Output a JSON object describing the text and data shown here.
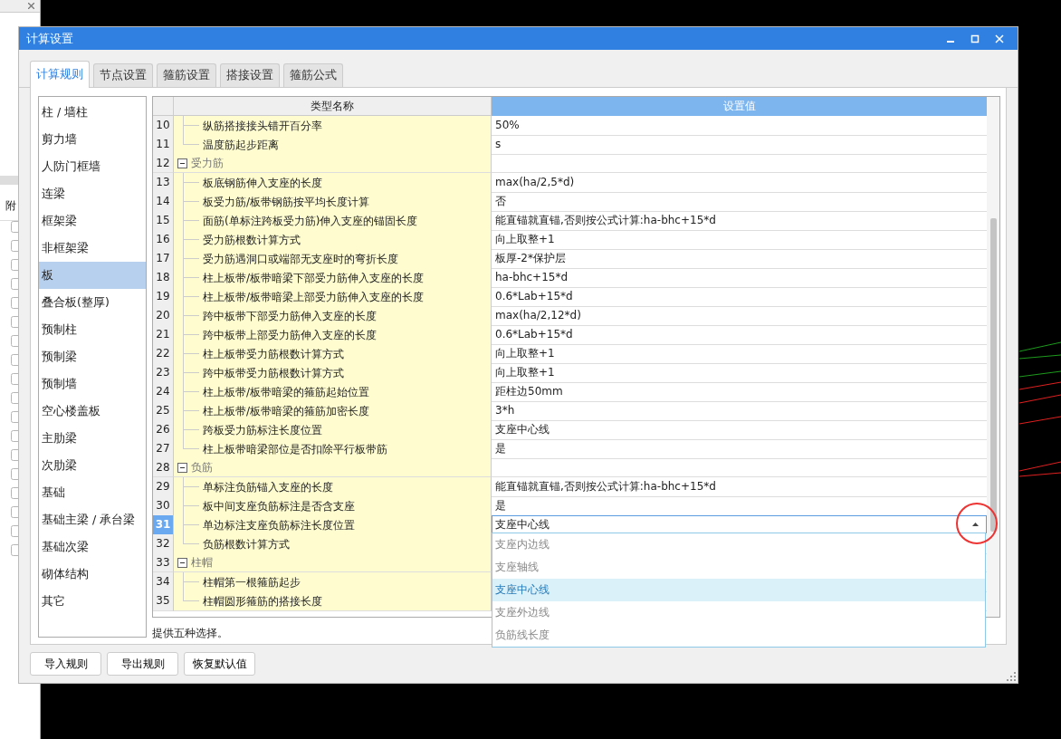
{
  "background_window": {
    "column_header": "附",
    "checkboxes": [
      {
        "checked": false
      },
      {
        "checked": false
      },
      {
        "checked": false
      },
      {
        "checked": false
      },
      {
        "checked": false
      },
      {
        "checked": false
      },
      {
        "checked": false
      },
      {
        "checked": false
      },
      {
        "checked": false
      },
      {
        "checked": false
      },
      {
        "checked": false
      },
      {
        "checked": false
      },
      {
        "checked": false
      },
      {
        "checked": false
      },
      {
        "checked": false
      },
      {
        "checked": false
      },
      {
        "checked": false
      },
      {
        "checked": false
      }
    ]
  },
  "window": {
    "title": "计算设置"
  },
  "tabs": [
    {
      "label": "计算规则",
      "selected": true
    },
    {
      "label": "节点设置",
      "selected": false
    },
    {
      "label": "箍筋设置",
      "selected": false
    },
    {
      "label": "搭接设置",
      "selected": false
    },
    {
      "label": "箍筋公式",
      "selected": false
    }
  ],
  "sidebar": {
    "items": [
      {
        "label": "柱 / 墙柱",
        "selected": false
      },
      {
        "label": "剪力墙",
        "selected": false
      },
      {
        "label": "人防门框墙",
        "selected": false
      },
      {
        "label": "连梁",
        "selected": false
      },
      {
        "label": "框架梁",
        "selected": false
      },
      {
        "label": "非框架梁",
        "selected": false
      },
      {
        "label": "板",
        "selected": true
      },
      {
        "label": "叠合板(整厚)",
        "selected": false
      },
      {
        "label": "预制柱",
        "selected": false
      },
      {
        "label": "预制梁",
        "selected": false
      },
      {
        "label": "预制墙",
        "selected": false
      },
      {
        "label": "空心楼盖板",
        "selected": false
      },
      {
        "label": "主肋梁",
        "selected": false
      },
      {
        "label": "次肋梁",
        "selected": false
      },
      {
        "label": "基础",
        "selected": false
      },
      {
        "label": "基础主梁 / 承台梁",
        "selected": false
      },
      {
        "label": "基础次梁",
        "selected": false
      },
      {
        "label": "砌体结构",
        "selected": false
      },
      {
        "label": "其它",
        "selected": false
      }
    ]
  },
  "table": {
    "columns": [
      "类型名称",
      "设置值"
    ],
    "rows": [
      {
        "number": "10",
        "kind": "item",
        "name": "纵筋搭接接头错开百分率",
        "value": "50%",
        "selected": false,
        "editing": false
      },
      {
        "number": "11",
        "kind": "item",
        "name": "温度筋起步距离",
        "value": "s",
        "selected": false,
        "editing": false
      },
      {
        "number": "12",
        "kind": "group",
        "name": "受力筋",
        "expanded": true,
        "selected": false,
        "editing": false
      },
      {
        "number": "13",
        "kind": "item",
        "name": "板底钢筋伸入支座的长度",
        "value": "max(ha/2,5*d)",
        "selected": false,
        "editing": false
      },
      {
        "number": "14",
        "kind": "item",
        "name": "板受力筋/板带钢筋按平均长度计算",
        "value": "否",
        "selected": false,
        "editing": false
      },
      {
        "number": "15",
        "kind": "item",
        "name": "面筋(单标注跨板受力筋)伸入支座的锚固长度",
        "value": "能直锚就直锚,否则按公式计算:ha-bhc+15*d",
        "selected": false,
        "editing": false
      },
      {
        "number": "16",
        "kind": "item",
        "name": "受力筋根数计算方式",
        "value": "向上取整+1",
        "selected": false,
        "editing": false
      },
      {
        "number": "17",
        "kind": "item",
        "name": "受力筋遇洞口或端部无支座时的弯折长度",
        "value": "板厚-2*保护层",
        "selected": false,
        "editing": false
      },
      {
        "number": "18",
        "kind": "item",
        "name": "柱上板带/板带暗梁下部受力筋伸入支座的长度",
        "value": "ha-bhc+15*d",
        "selected": false,
        "editing": false
      },
      {
        "number": "19",
        "kind": "item",
        "name": "柱上板带/板带暗梁上部受力筋伸入支座的长度",
        "value": "0.6*Lab+15*d",
        "selected": false,
        "editing": false
      },
      {
        "number": "20",
        "kind": "item",
        "name": "跨中板带下部受力筋伸入支座的长度",
        "value": "max(ha/2,12*d)",
        "selected": false,
        "editing": false
      },
      {
        "number": "21",
        "kind": "item",
        "name": "跨中板带上部受力筋伸入支座的长度",
        "value": "0.6*Lab+15*d",
        "selected": false,
        "editing": false
      },
      {
        "number": "22",
        "kind": "item",
        "name": "柱上板带受力筋根数计算方式",
        "value": "向上取整+1",
        "selected": false,
        "editing": false
      },
      {
        "number": "23",
        "kind": "item",
        "name": "跨中板带受力筋根数计算方式",
        "value": "向上取整+1",
        "selected": false,
        "editing": false
      },
      {
        "number": "24",
        "kind": "item",
        "name": "柱上板带/板带暗梁的箍筋起始位置",
        "value": "距柱边50mm",
        "selected": false,
        "editing": false
      },
      {
        "number": "25",
        "kind": "item",
        "name": "柱上板带/板带暗梁的箍筋加密长度",
        "value": "3*h",
        "selected": false,
        "editing": false
      },
      {
        "number": "26",
        "kind": "item",
        "name": "跨板受力筋标注长度位置",
        "value": "支座中心线",
        "selected": false,
        "editing": false
      },
      {
        "number": "27",
        "kind": "item",
        "name": "柱上板带暗梁部位是否扣除平行板带筋",
        "value": "是",
        "selected": false,
        "editing": false
      },
      {
        "number": "28",
        "kind": "group",
        "name": "负筋",
        "expanded": true,
        "selected": false,
        "editing": false
      },
      {
        "number": "29",
        "kind": "item",
        "name": "单标注负筋锚入支座的长度",
        "value": "能直锚就直锚,否则按公式计算:ha-bhc+15*d",
        "selected": false,
        "editing": false
      },
      {
        "number": "30",
        "kind": "item",
        "name": "板中间支座负筋标注是否含支座",
        "value": "是",
        "selected": false,
        "editing": false
      },
      {
        "number": "31",
        "kind": "item",
        "name": "单边标注支座负筋标注长度位置",
        "value": "支座中心线",
        "selected": true,
        "editing": true
      },
      {
        "number": "32",
        "kind": "item",
        "name": "负筋根数计算方式",
        "selected": false,
        "editing": false
      },
      {
        "number": "33",
        "kind": "group",
        "name": "柱帽",
        "expanded": true,
        "selected": false,
        "editing": false
      },
      {
        "number": "34",
        "kind": "item",
        "name": "柱帽第一根箍筋起步",
        "selected": false,
        "editing": false
      },
      {
        "number": "35",
        "kind": "item",
        "name": "柱帽圆形箍筋的搭接长度",
        "selected": false,
        "editing": false
      }
    ],
    "dropdown": {
      "options": [
        {
          "label": "支座内边线",
          "selected": false
        },
        {
          "label": "支座轴线",
          "selected": false
        },
        {
          "label": "支座中心线",
          "selected": true
        },
        {
          "label": "支座外边线",
          "selected": false
        },
        {
          "label": "负筋线长度",
          "selected": false
        }
      ]
    }
  },
  "description": "提供五种选择。",
  "buttons": [
    "导入规则",
    "导出规则",
    "恢复默认值"
  ]
}
